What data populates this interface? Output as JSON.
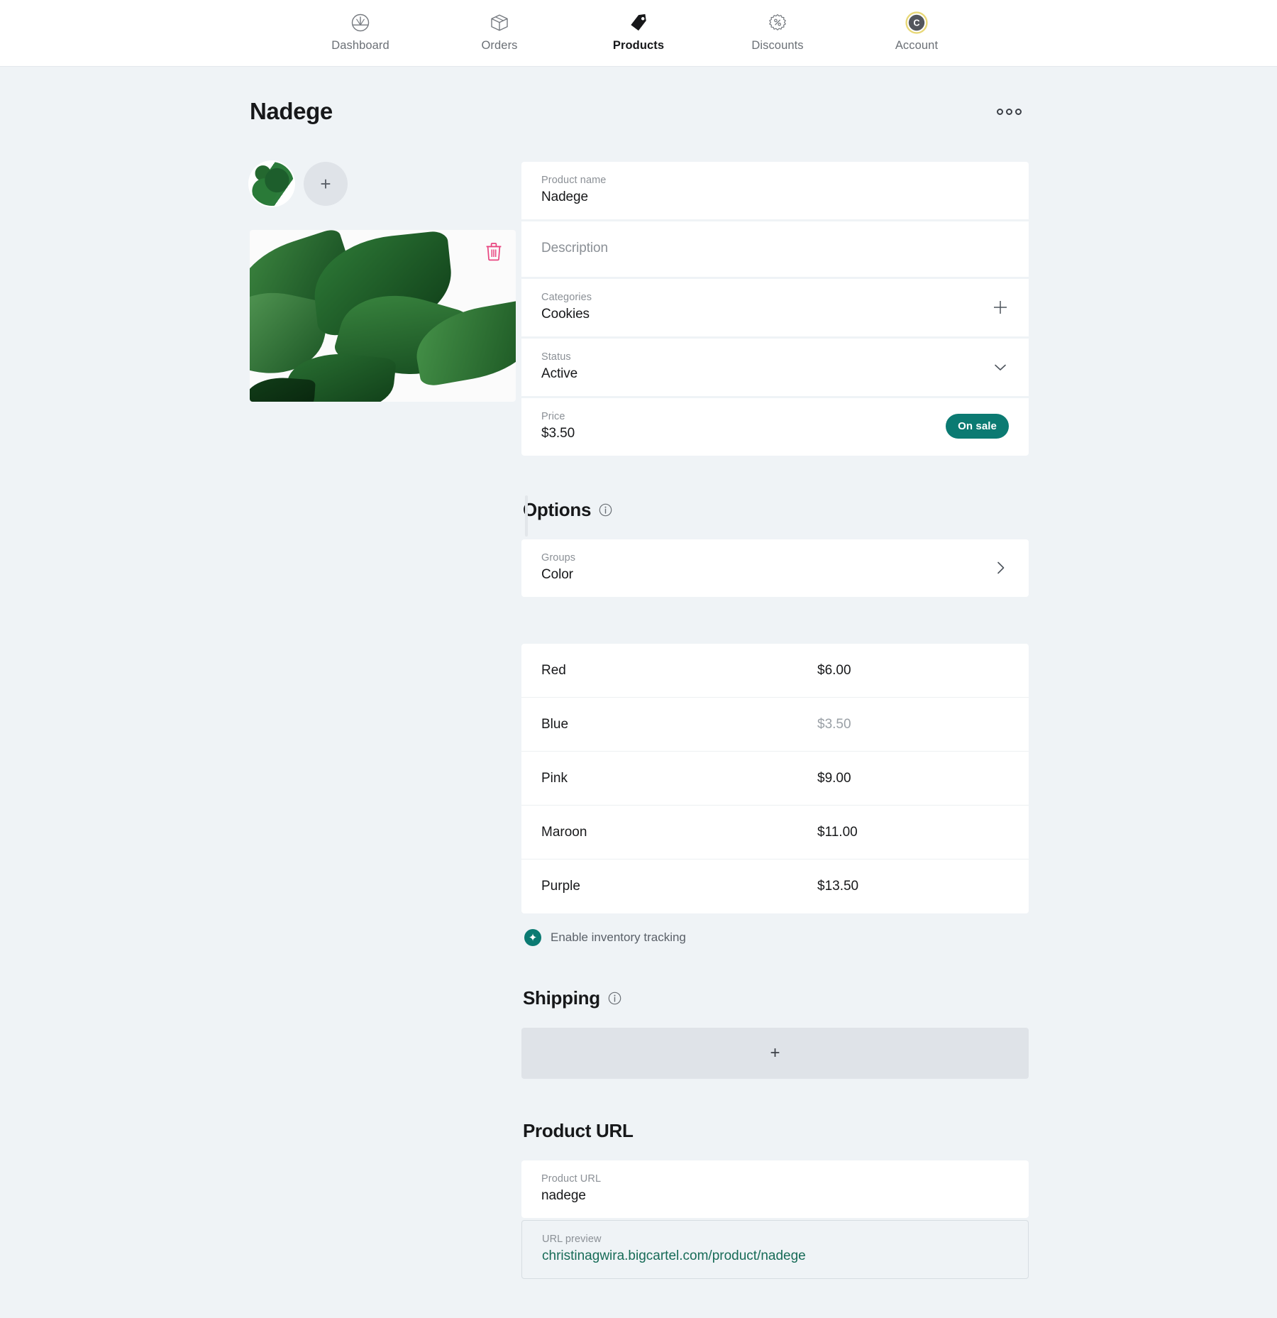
{
  "nav": {
    "items": [
      {
        "label": "Dashboard",
        "icon": "gauge-icon",
        "active": false
      },
      {
        "label": "Orders",
        "icon": "box-icon",
        "active": false
      },
      {
        "label": "Products",
        "icon": "tag-icon",
        "active": true
      },
      {
        "label": "Discounts",
        "icon": "percent-badge-icon",
        "active": false
      },
      {
        "label": "Account",
        "icon": "avatar-icon",
        "active": false
      }
    ],
    "avatar_initial": "C"
  },
  "header": {
    "title": "Nadege",
    "overflow_menu": "•••"
  },
  "media": {
    "add_thumb_glyph": "+",
    "delete_glyph": "trash-icon"
  },
  "details": {
    "product_name": {
      "label": "Product name",
      "value": "Nadege"
    },
    "description": {
      "label": "Description",
      "placeholder": "Description",
      "value": ""
    },
    "categories": {
      "label": "Categories",
      "value": "Cookies",
      "action_glyph": "+"
    },
    "status": {
      "label": "Status",
      "value": "Active",
      "options": [
        "Active"
      ]
    },
    "price": {
      "label": "Price",
      "value": "$3.50",
      "badge": "On sale"
    }
  },
  "options": {
    "title": "Options",
    "info_glyph": "i",
    "groups": {
      "label": "Groups",
      "value": "Color"
    },
    "variants": [
      {
        "name": "Red",
        "price": "$6.00",
        "muted": false
      },
      {
        "name": "Blue",
        "price": "$3.50",
        "muted": true
      },
      {
        "name": "Pink",
        "price": "$9.00",
        "muted": false
      },
      {
        "name": "Maroon",
        "price": "$11.00",
        "muted": false
      },
      {
        "name": "Purple",
        "price": "$13.50",
        "muted": false
      }
    ],
    "inventory": {
      "label": "Enable inventory tracking",
      "checked": true,
      "check_glyph": "✦"
    }
  },
  "shipping": {
    "title": "Shipping",
    "info_glyph": "i",
    "add_glyph": "+"
  },
  "product_url": {
    "title": "Product URL",
    "slug": {
      "label": "Product URL",
      "value": "nadege"
    },
    "preview": {
      "label": "URL preview",
      "value": "christinagwira.bigcartel.com/product/nadege"
    }
  },
  "colors": {
    "accent_teal": "#0b7a72",
    "link_green": "#176b57",
    "delete_pink": "#e8447f",
    "page_bg": "#eff3f6",
    "avatar_ring": "#e8d878"
  }
}
